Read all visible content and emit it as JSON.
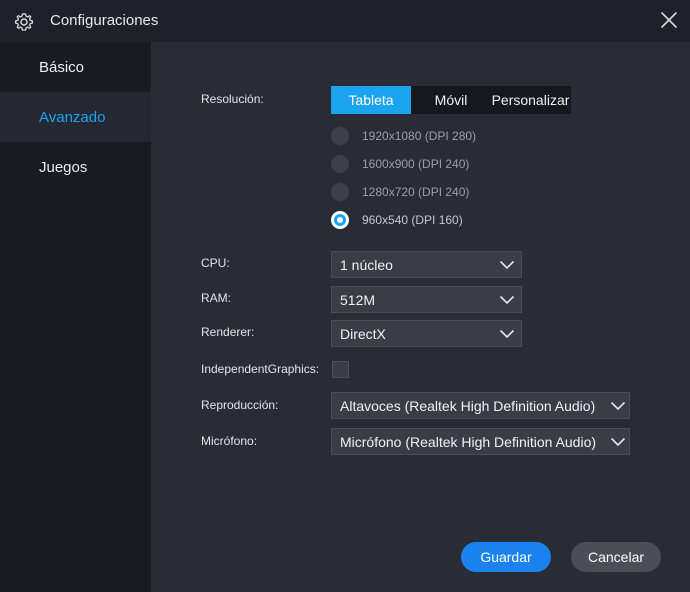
{
  "window": {
    "title": "Configuraciones",
    "gear_icon": "gear-icon",
    "close_icon": "close-icon"
  },
  "sidebar": {
    "items": [
      {
        "label": "Básico",
        "active": false
      },
      {
        "label": "Avanzado",
        "active": true
      },
      {
        "label": "Juegos",
        "active": false
      }
    ]
  },
  "resolution": {
    "label": "Resolución:",
    "tabs": [
      {
        "label": "Tableta",
        "active": true
      },
      {
        "label": "Móvil",
        "active": false
      },
      {
        "label": "Personalizar",
        "active": false
      }
    ],
    "options": [
      {
        "label": "1920x1080 (DPI 280)",
        "checked": false
      },
      {
        "label": "1600x900 (DPI 240)",
        "checked": false
      },
      {
        "label": "1280x720 (DPI 240)",
        "checked": false
      },
      {
        "label": "960x540 (DPI 160)",
        "checked": true
      }
    ]
  },
  "cpu": {
    "label": "CPU:",
    "value": "1 núcleo"
  },
  "ram": {
    "label": "RAM:",
    "value": "512M"
  },
  "renderer": {
    "label": "Renderer:",
    "value": "DirectX"
  },
  "independent_graphics": {
    "label": "IndependentGraphics:",
    "checked": false
  },
  "playback": {
    "label": "Reproducción:",
    "value": "Altavoces (Realtek High Definition Audio)"
  },
  "microphone": {
    "label": "Micrófono:",
    "value": "Micrófono (Realtek High Definition Audio)"
  },
  "actions": {
    "save": "Guardar",
    "cancel": "Cancelar"
  },
  "colors": {
    "accent": "#1aa4ef",
    "primary_button": "#1a83f0",
    "sidebar_bg": "#1a1b22",
    "panel_bg": "#292b37"
  }
}
